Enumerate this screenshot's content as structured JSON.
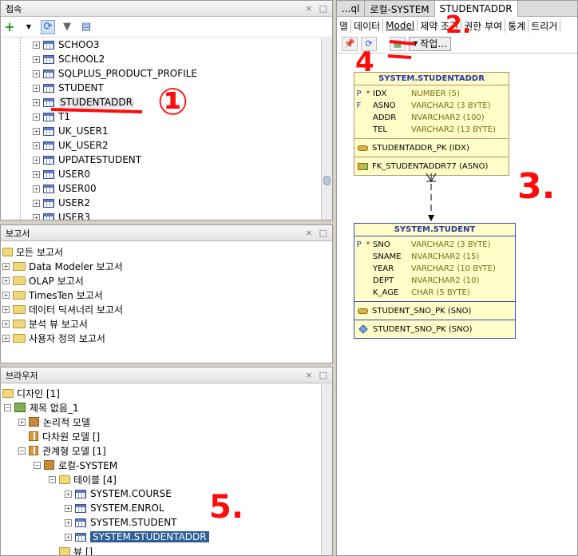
{
  "connections": {
    "title": "접속",
    "toolbar": {
      "add_icon": "plus-icon",
      "refresh_icon": "refresh-icon",
      "filter_icon": "filter-icon",
      "schema_icon": "schema-browser-icon"
    },
    "tables": [
      "SCHOO3",
      "SCHOOL2",
      "SQLPLUS_PRODUCT_PROFILE",
      "STUDENT",
      "STUDENTADDR",
      "T1",
      "UK_USER1",
      "UK_USER2",
      "UPDATESTUDENT",
      "USER0",
      "USER00",
      "USER2",
      "USER3"
    ]
  },
  "reports": {
    "title": "보고서",
    "root": "모든 보고서",
    "items": [
      "Data Modeler 보고서",
      "OLAP 보고서",
      "TimesTen 보고서",
      "데이터 딕셔너리 보고서",
      "분석 뷰 보고서",
      "사용자 정의 보고서"
    ]
  },
  "browser": {
    "title": "브라우저",
    "design": "디자인 [1]",
    "untitled": "제목 없음_1",
    "logical": "논리적 모델",
    "multidim": "다차원 모델 []",
    "relational": "관계형 모델 [1]",
    "local": "로컬-SYSTEM",
    "tables_label": "테이블 [4]",
    "tables": [
      "SYSTEM.COURSE",
      "SYSTEM.ENROL",
      "SYSTEM.STUDENT",
      "SYSTEM.STUDENTADDR"
    ],
    "views": "뷰 []"
  },
  "right": {
    "tabs": [
      "...ql",
      "로컬-SYSTEM",
      "STUDENTADDR"
    ],
    "subtabs": [
      "열",
      "데이터",
      "Model",
      "제약 조건",
      "권한 부여",
      "통계",
      "트리거"
    ],
    "action_label": "작업..."
  },
  "diagram": {
    "entity1": {
      "name": "SYSTEM.STUDENTADDR",
      "columns": [
        {
          "key": "P",
          "star": "*",
          "name": "IDX",
          "type": "NUMBER (5)"
        },
        {
          "key": "F",
          "star": "",
          "name": "ASNO",
          "type": "VARCHAR2 (3 BYTE)"
        },
        {
          "key": "",
          "star": "",
          "name": "ADDR",
          "type": "NVARCHAR2 (100)"
        },
        {
          "key": "",
          "star": "",
          "name": "TEL",
          "type": "VARCHAR2 (13 BYTE)"
        }
      ],
      "pk": "STUDENTADDR_PK (IDX)",
      "fk": "FK_STUDENTADDR77 (ASNO)"
    },
    "entity2": {
      "name": "SYSTEM.STUDENT",
      "columns": [
        {
          "key": "P",
          "star": "*",
          "name": "SNO",
          "type": "VARCHAR2 (3 BYTE)"
        },
        {
          "key": "",
          "star": "",
          "name": "SNAME",
          "type": "NVARCHAR2 (15)"
        },
        {
          "key": "",
          "star": "",
          "name": "YEAR",
          "type": "VARCHAR2 (10 BYTE)"
        },
        {
          "key": "",
          "star": "",
          "name": "DEPT",
          "type": "NVARCHAR2 (10)"
        },
        {
          "key": "",
          "star": "",
          "name": "K_AGE",
          "type": "CHAR (5 BYTE)"
        }
      ],
      "pk": "STUDENT_SNO_PK (SNO)",
      "idx": "STUDENT_SNO_PK (SNO)"
    }
  },
  "annotations": {
    "a1": "①",
    "a2": "2.",
    "a3": "3.",
    "a4": "4",
    "a5": "5."
  },
  "colors": {
    "annotation": "#ff0b0b",
    "entity_bg": "#fffec8",
    "entity1_border": "#c08e6a",
    "entity2_border": "#3648b8",
    "selection": "#2f5e96"
  }
}
